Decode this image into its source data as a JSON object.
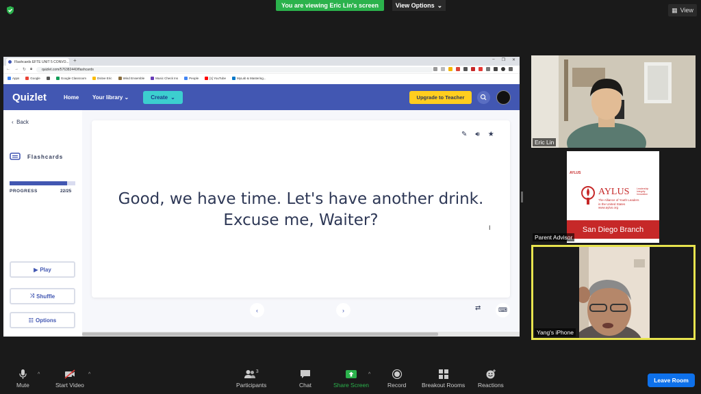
{
  "banner": {
    "viewing": "You are viewing Eric Lin's screen",
    "view_options": "View Options",
    "view": "View"
  },
  "browser": {
    "tab_title": "Flashcards EFTE UNIT 5 CONVO...",
    "url": "quizlet.com/576382440/flashcards",
    "bookmarks": [
      {
        "label": "Apps",
        "color": "#4285f4"
      },
      {
        "label": "Google",
        "color": "#ea4335"
      },
      {
        "label": "",
        "color": "#555555"
      },
      {
        "label": "Google Classroom",
        "color": "#0f9d58"
      },
      {
        "label": "Dsitve Eric",
        "color": "#fbbc05"
      },
      {
        "label": "Wind Ensemble",
        "color": "#8a6d3b"
      },
      {
        "label": "Music Check Ins",
        "color": "#673ab7"
      },
      {
        "label": "People",
        "color": "#4285f4"
      },
      {
        "label": "[1] YouTube",
        "color": "#ff0000"
      },
      {
        "label": "MyLab & Mastering...",
        "color": "#0077c8"
      }
    ]
  },
  "quizlet": {
    "logo": "Quizlet",
    "home": "Home",
    "library": "Your library",
    "create": "Create",
    "upgrade": "Upgrade to Teacher",
    "back": "Back",
    "mode": "Flashcards",
    "progress_label": "PROGRESS",
    "progress_count": "22/25",
    "progress_fraction": 0.88,
    "play": "Play",
    "shuffle": "Shuffle",
    "options": "Options",
    "card_line1": "Good, we have time. Let's have another drink.",
    "card_line2": "Excuse me, Waiter?"
  },
  "participants": {
    "p1": "Eric Lin",
    "p2": "Parent Advisor",
    "p3": "Yang's iPhone",
    "aylus": {
      "badge": "AYLUS",
      "name": "AYLUS",
      "tagline1": "Leadership",
      "tagline2": "Integrity",
      "tagline3": "Innovation",
      "full": "The Alliance of Youth Leaders",
      "full2": "in the United States",
      "site": "www.aylus.org",
      "branch": "San Diego Branch"
    }
  },
  "toolbar": {
    "mute": "Mute",
    "video": "Start Video",
    "participants": "Participants",
    "participant_count": "3",
    "chat": "Chat",
    "share": "Share Screen",
    "record": "Record",
    "breakout": "Breakout Rooms",
    "reactions": "Reactions",
    "leave": "Leave Room"
  },
  "colors": {
    "zoom_green": "#2bb24c",
    "quizlet_blue": "#4257b2",
    "quizlet_yellow": "#ffcd1f",
    "quizlet_teal": "#3ccfcf",
    "leave_blue": "#0e71eb",
    "active_speaker": "#e8e44e"
  }
}
